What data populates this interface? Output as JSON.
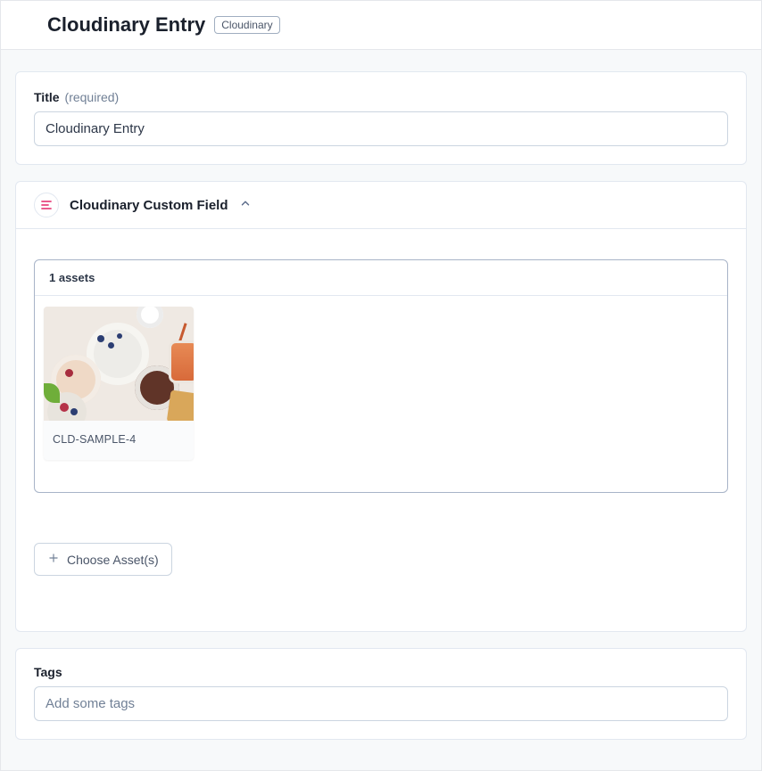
{
  "header": {
    "title": "Cloudinary Entry",
    "badge": "Cloudinary"
  },
  "title_field": {
    "label": "Title",
    "required_text": "(required)",
    "value": "Cloudinary Entry"
  },
  "custom_field": {
    "section_title": "Cloudinary Custom Field",
    "assets_count_label": "1 assets",
    "assets": [
      {
        "name": "CLD-SAMPLE-4"
      }
    ],
    "choose_button": "Choose Asset(s)"
  },
  "tags_field": {
    "label": "Tags",
    "placeholder": "Add some tags"
  }
}
